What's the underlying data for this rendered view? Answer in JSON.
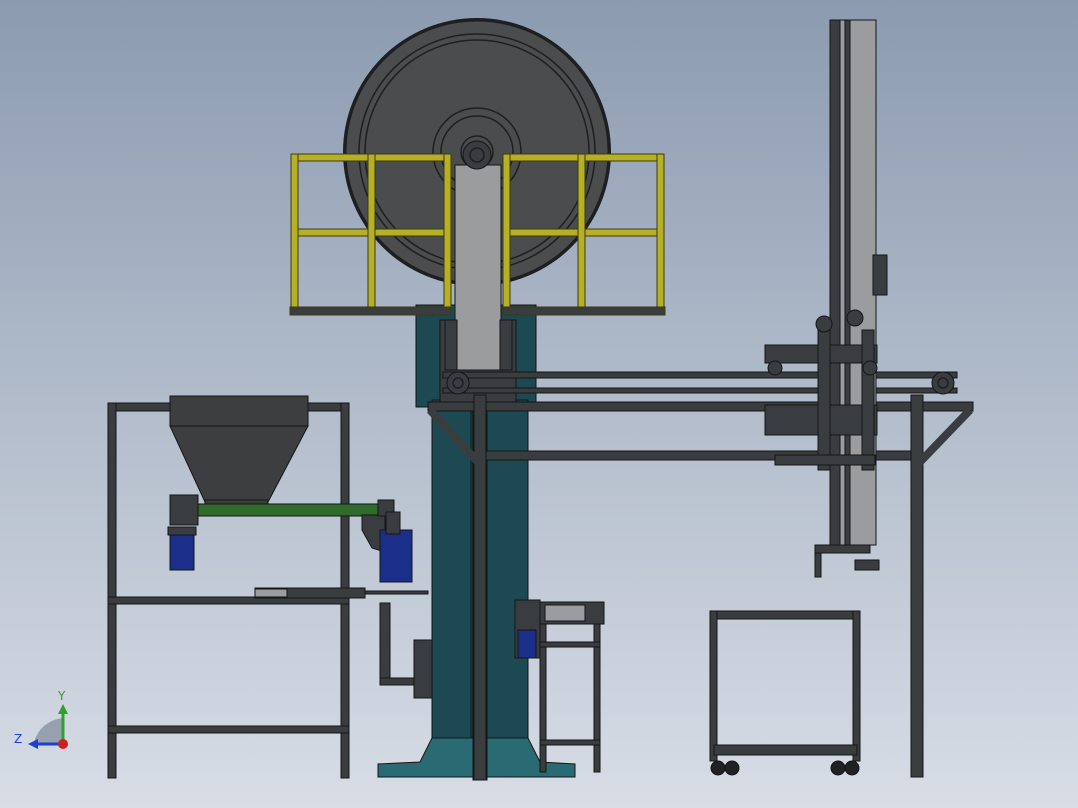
{
  "viewport": {
    "background_top": "#8C9BB0",
    "background_bottom": "#D8DDE6"
  },
  "colors": {
    "frame": "#3A3D40",
    "frame_edge": "#141516",
    "rail_yellow": "#B5B028",
    "rail_edge": "#3E3B08",
    "column_teal": "#1D4A52",
    "column_teal_dark": "#123238",
    "base_teal": "#2A6A72",
    "wheel_dark": "#4A4C4E",
    "wheel_rim": "#1E1F20",
    "hopper": "#3C3E40",
    "screw_green": "#2F6B2A",
    "motor_blue": "#1A2F8A",
    "tower_light": "#9A9C9E",
    "caster_dark": "#202122"
  },
  "triad": {
    "y_label": "Y",
    "z_label": "Z",
    "y_color": "#2EA02E",
    "z_color": "#1E3FD6",
    "origin_color": "#D0201E"
  },
  "icons": {
    "triad": "coordinate-axes-icon"
  }
}
